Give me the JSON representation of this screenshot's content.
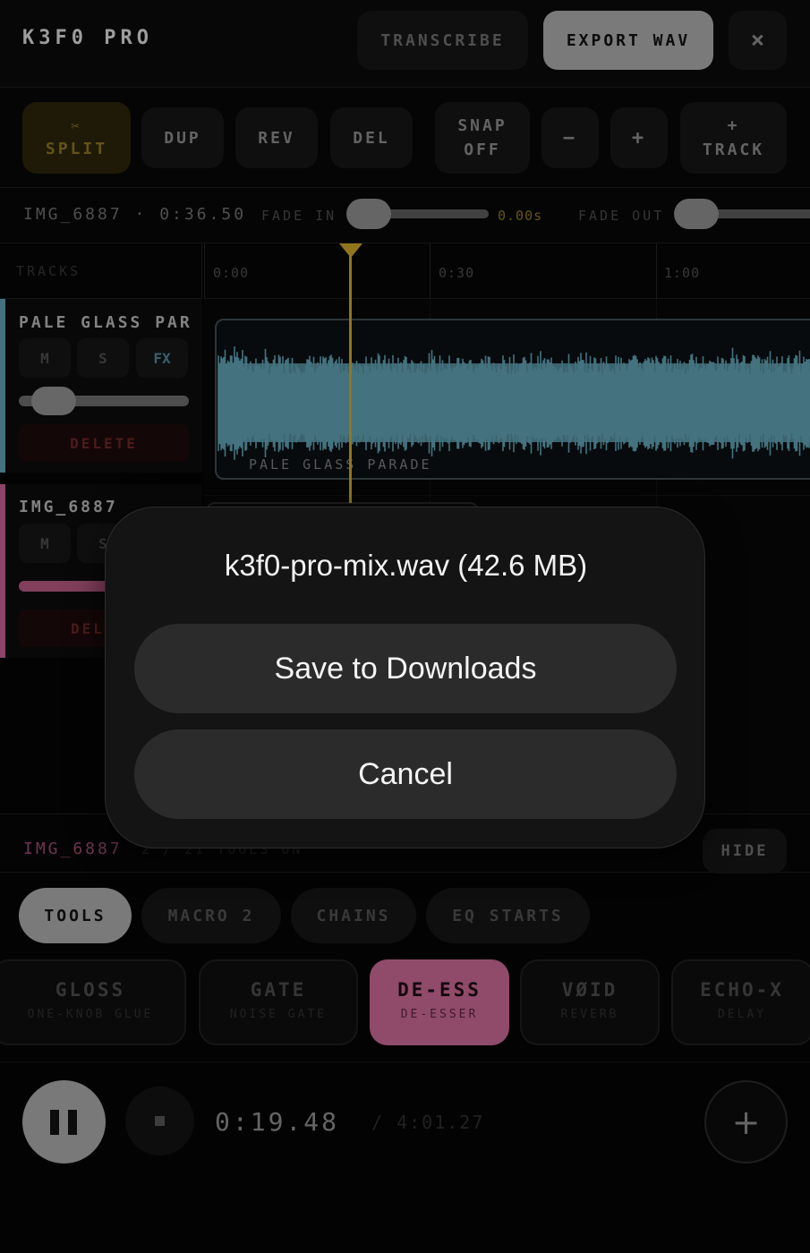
{
  "header": {
    "title": "K3F0 PRO",
    "transcribe_label": "TRANSCRIBE",
    "export_label": "EXPORT WAV",
    "close_label": "×"
  },
  "toolbar": {
    "split_icon": "✂",
    "split_label": "SPLIT",
    "dup_label": "DUP",
    "rev_label": "REV",
    "del_label": "DEL",
    "snap_line1": "SNAP",
    "snap_line2": "OFF",
    "minus_label": "−",
    "plus_label": "+",
    "track_line1": "+",
    "track_line2": "TRACK"
  },
  "clip_info": {
    "clip_name": "IMG_6887 · 0:36.50",
    "fade_in_label": "FADE IN",
    "fade_in_value": "0.00s",
    "fade_out_label": "FADE OUT",
    "fade_in_level": 0,
    "fade_out_level": 0
  },
  "timeline": {
    "tracks_label": "TRACKS",
    "ruler": [
      "0:00",
      "0:30",
      "1:00"
    ],
    "playhead_color": "#c9a227",
    "tracks": [
      {
        "name": "PALE GLASS PAR",
        "m": "M",
        "s": "S",
        "fx": "FX",
        "delete_label": "DELETE",
        "color": "#5f9fb0",
        "volume_level": 0.2,
        "clip_label": "PALE GLASS PARADE"
      },
      {
        "name": "IMG_6887",
        "m": "M",
        "s": "S",
        "delete_label": "DEL",
        "color": "#c0608f"
      }
    ]
  },
  "modal": {
    "title": "k3f0-pro-mix.wav (42.6 MB)",
    "save_label": "Save to Downloads",
    "cancel_label": "Cancel"
  },
  "fx_bar": {
    "track_name": "IMG_6887",
    "status": "2 / 21 TOOLS ON",
    "hide_label": "HIDE"
  },
  "tabs": [
    {
      "label": "TOOLS",
      "active": true
    },
    {
      "label": "MACRO 2",
      "active": false
    },
    {
      "label": "CHAINS",
      "active": false
    },
    {
      "label": "EQ STARTS",
      "active": false
    }
  ],
  "tools": [
    {
      "name": "GLOSS",
      "sub": "ONE-KNOB GLUE",
      "active": false
    },
    {
      "name": "GATE",
      "sub": "NOISE GATE",
      "active": false
    },
    {
      "name": "DE-ESS",
      "sub": "DE-ESSER",
      "active": true
    },
    {
      "name": "VØID",
      "sub": "REVERB",
      "active": false
    },
    {
      "name": "ECHO-X",
      "sub": "DELAY",
      "active": false
    }
  ],
  "transport": {
    "current_time": "0:19.48",
    "total_time": "/ 4:01.27",
    "add_label": "+"
  },
  "colors": {
    "accent_gold": "#c9a227",
    "track1": "#5f9fb0",
    "track2": "#c0608f",
    "active_tool": "#c86894"
  }
}
